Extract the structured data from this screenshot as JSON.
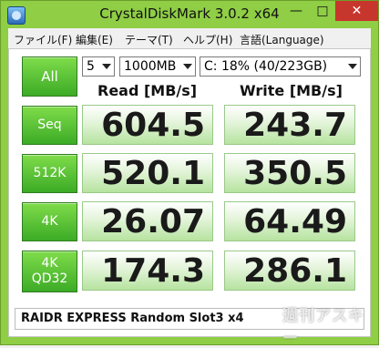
{
  "window": {
    "title": "CrystalDiskMark 3.0.2 x64",
    "controls": {
      "minimize": "—",
      "maximize": "□",
      "close": "✕"
    }
  },
  "menu": [
    "ファイル(F)",
    "編集(E)",
    "テーマ(T)",
    "ヘルプ(H)",
    "言語(Language)"
  ],
  "toolbar": {
    "all_label": "All",
    "runs": "5",
    "size": "1000MB",
    "drive": "C: 18% (40/223GB)"
  },
  "columns": {
    "read": "Read [MB/s]",
    "write": "Write [MB/s]"
  },
  "rows": [
    {
      "label": [
        "Seq"
      ],
      "read": "604.5",
      "write": "243.7"
    },
    {
      "label": [
        "512K"
      ],
      "read": "520.1",
      "write": "350.5"
    },
    {
      "label": [
        "4K"
      ],
      "read": "26.07",
      "write": "64.49"
    },
    {
      "label": [
        "4K",
        "QD32"
      ],
      "read": "174.3",
      "write": "286.1"
    }
  ],
  "comment": "RAIDR EXPRESS Random Slot3 x4",
  "watermark": "週刊アスキー",
  "colors": {
    "frame": "#8fce45",
    "button": "#3cab26",
    "close": "#c7362d"
  }
}
